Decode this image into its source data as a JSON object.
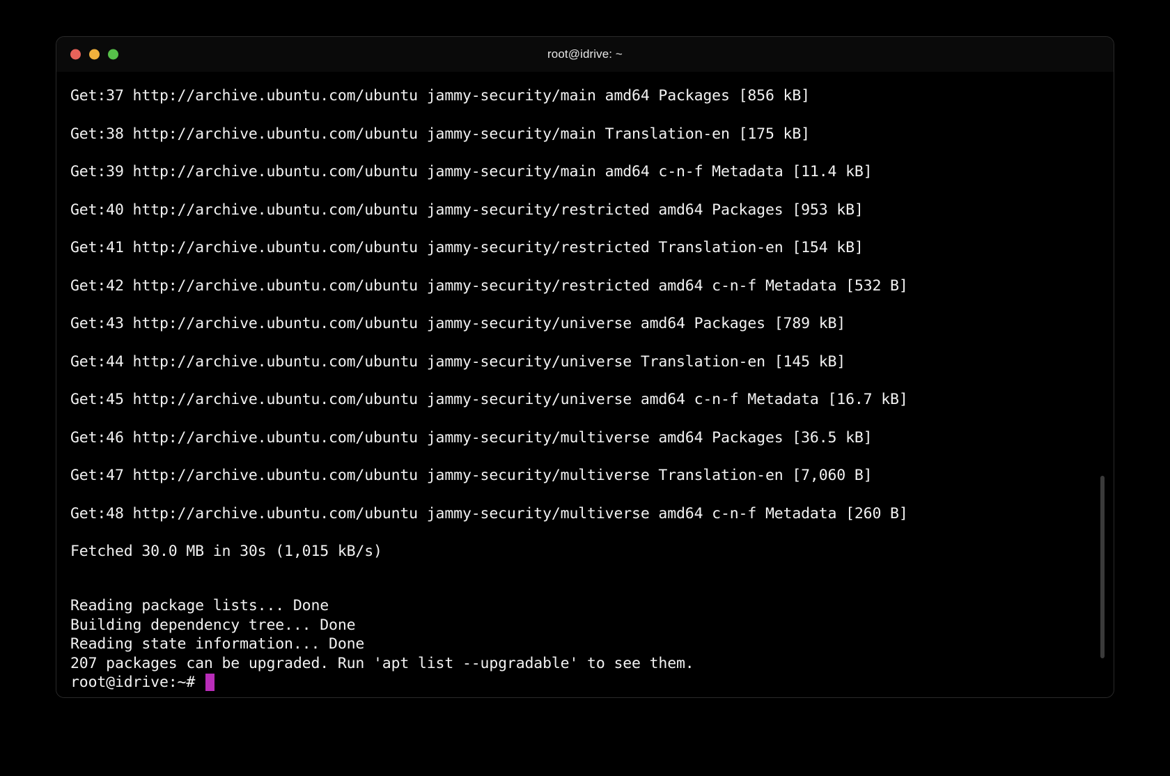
{
  "window": {
    "title": "root@idrive: ~",
    "traffic_lights": [
      {
        "name": "close",
        "color": "#e8635a"
      },
      {
        "name": "minimize",
        "color": "#f0b03c"
      },
      {
        "name": "maximize",
        "color": "#57c04a"
      }
    ]
  },
  "terminal": {
    "cursor_color": "#b92db9",
    "text_color": "#f2f2f2",
    "background_color": "#000000",
    "scrollbar_color": "#3a3a3a",
    "download_lines": [
      "Get:37 http://archive.ubuntu.com/ubuntu jammy-security/main amd64 Packages [856 kB]",
      "Get:38 http://archive.ubuntu.com/ubuntu jammy-security/main Translation-en [175 kB]",
      "Get:39 http://archive.ubuntu.com/ubuntu jammy-security/main amd64 c-n-f Metadata [11.4 kB]",
      "Get:40 http://archive.ubuntu.com/ubuntu jammy-security/restricted amd64 Packages [953 kB]",
      "Get:41 http://archive.ubuntu.com/ubuntu jammy-security/restricted Translation-en [154 kB]",
      "Get:42 http://archive.ubuntu.com/ubuntu jammy-security/restricted amd64 c-n-f Metadata [532 B]",
      "Get:43 http://archive.ubuntu.com/ubuntu jammy-security/universe amd64 Packages [789 kB]",
      "Get:44 http://archive.ubuntu.com/ubuntu jammy-security/universe Translation-en [145 kB]",
      "Get:45 http://archive.ubuntu.com/ubuntu jammy-security/universe amd64 c-n-f Metadata [16.7 kB]",
      "Get:46 http://archive.ubuntu.com/ubuntu jammy-security/multiverse amd64 Packages [36.5 kB]",
      "Get:47 http://archive.ubuntu.com/ubuntu jammy-security/multiverse Translation-en [7,060 B]",
      "Get:48 http://archive.ubuntu.com/ubuntu jammy-security/multiverse amd64 c-n-f Metadata [260 B]"
    ],
    "fetched_line": "Fetched 30.0 MB in 30s (1,015 kB/s)",
    "summary_lines": [
      "Reading package lists... Done",
      "Building dependency tree... Done",
      "Reading state information... Done",
      "207 packages can be upgraded. Run 'apt list --upgradable' to see them."
    ],
    "prompt": "root@idrive:~# "
  }
}
